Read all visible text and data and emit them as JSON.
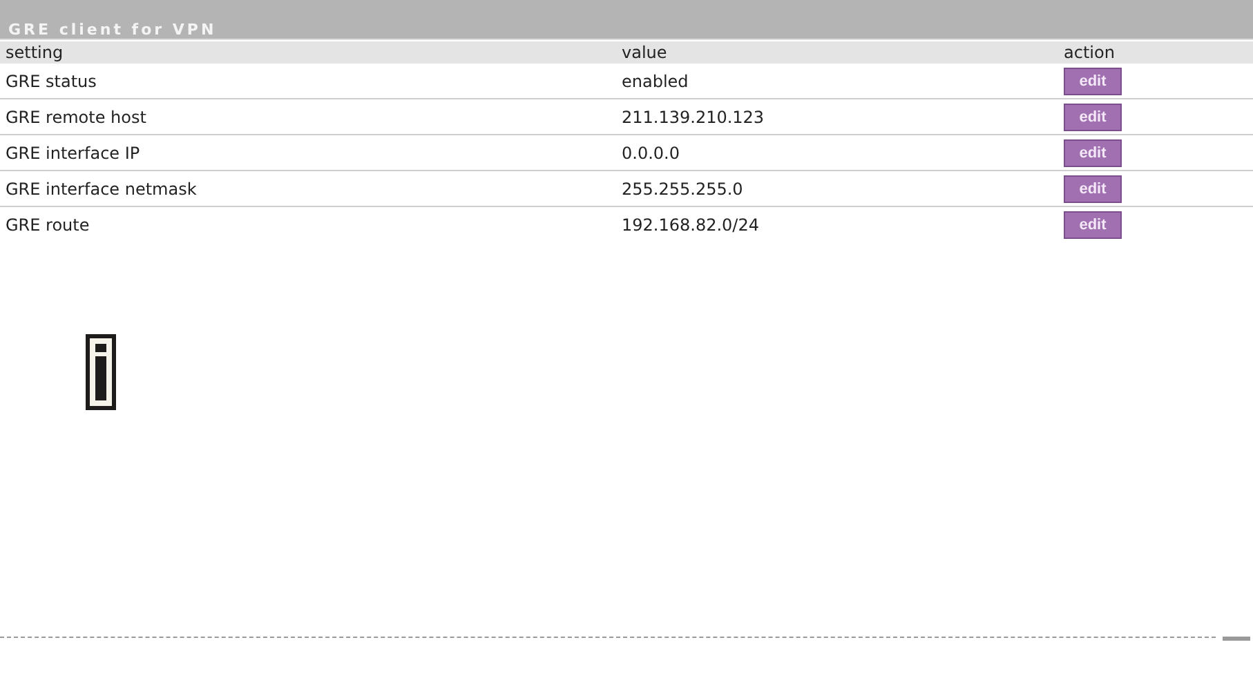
{
  "panel": {
    "title": "GRE client for VPN"
  },
  "table": {
    "columns": [
      "setting",
      "value",
      "action"
    ],
    "rows": [
      {
        "setting": "GRE status",
        "value": "enabled",
        "action": "edit"
      },
      {
        "setting": "GRE remote host",
        "value": "211.139.210.123",
        "action": "edit"
      },
      {
        "setting": "GRE interface IP",
        "value": "0.0.0.0",
        "action": "edit"
      },
      {
        "setting": "GRE interface netmask",
        "value": "255.255.255.0",
        "action": "edit"
      },
      {
        "setting": "GRE route",
        "value": "192.168.82.0/24",
        "action": "edit"
      }
    ]
  }
}
